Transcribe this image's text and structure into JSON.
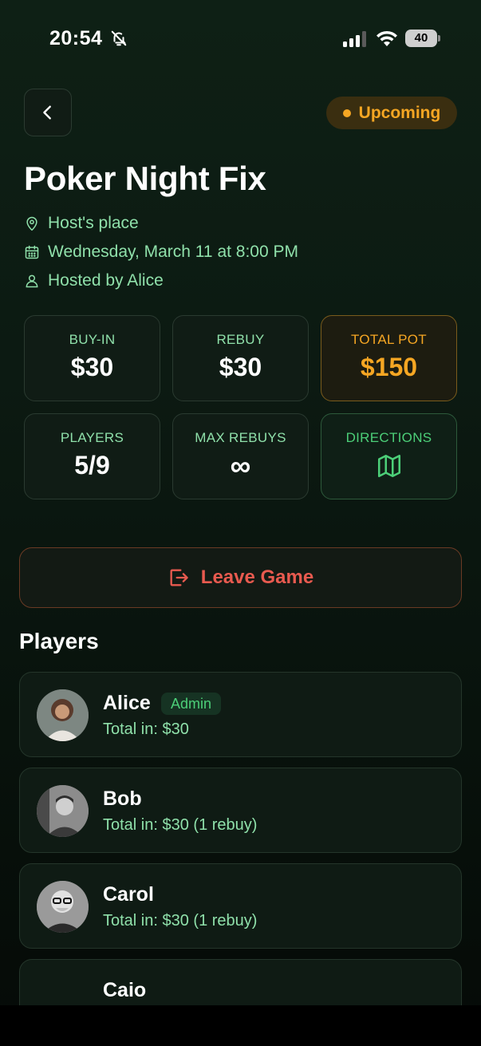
{
  "status_bar": {
    "time": "20:54",
    "battery": "40"
  },
  "header": {
    "status": "Upcoming"
  },
  "game": {
    "title": "Poker Night Fix",
    "location": "Host's place",
    "datetime": "Wednesday, March 11 at 8:00 PM",
    "host": "Hosted by Alice"
  },
  "stats": {
    "buyin_label": "BUY-IN",
    "buyin_value": "$30",
    "rebuy_label": "REBUY",
    "rebuy_value": "$30",
    "pot_label": "TOTAL POT",
    "pot_value": "$150",
    "players_label": "PLAYERS",
    "players_value": "5/9",
    "maxrebuys_label": "MAX REBUYS",
    "maxrebuys_value": "∞",
    "directions_label": "DIRECTIONS"
  },
  "actions": {
    "leave": "Leave Game"
  },
  "players_section": {
    "title": "Players",
    "items": [
      {
        "name": "Alice",
        "badge": "Admin",
        "total": "Total in: $30"
      },
      {
        "name": "Bob",
        "total": "Total in: $30 (1 rebuy)"
      },
      {
        "name": "Carol",
        "total": "Total in: $30 (1 rebuy)"
      },
      {
        "name": "Caio",
        "total": ""
      }
    ]
  },
  "colors": {
    "accent": "#4ccf78",
    "text_green": "#8fe0aa",
    "warning": "#f5a623",
    "danger": "#e85a4f"
  }
}
